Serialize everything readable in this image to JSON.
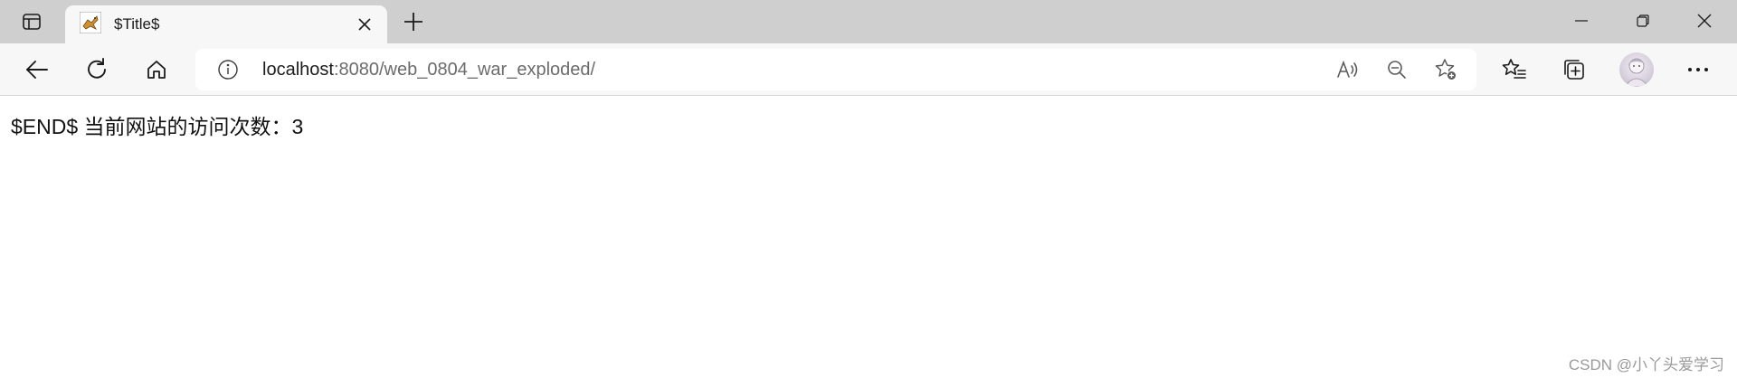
{
  "browser": {
    "tab": {
      "title": "$Title$"
    },
    "address_bar": {
      "url_host": "localhost",
      "url_path": ":8080/web_0804_war_exploded/"
    }
  },
  "page": {
    "text": "$END$ 当前网站的访问次数：3"
  },
  "watermark": "CSDN @小丫头爱学习"
}
